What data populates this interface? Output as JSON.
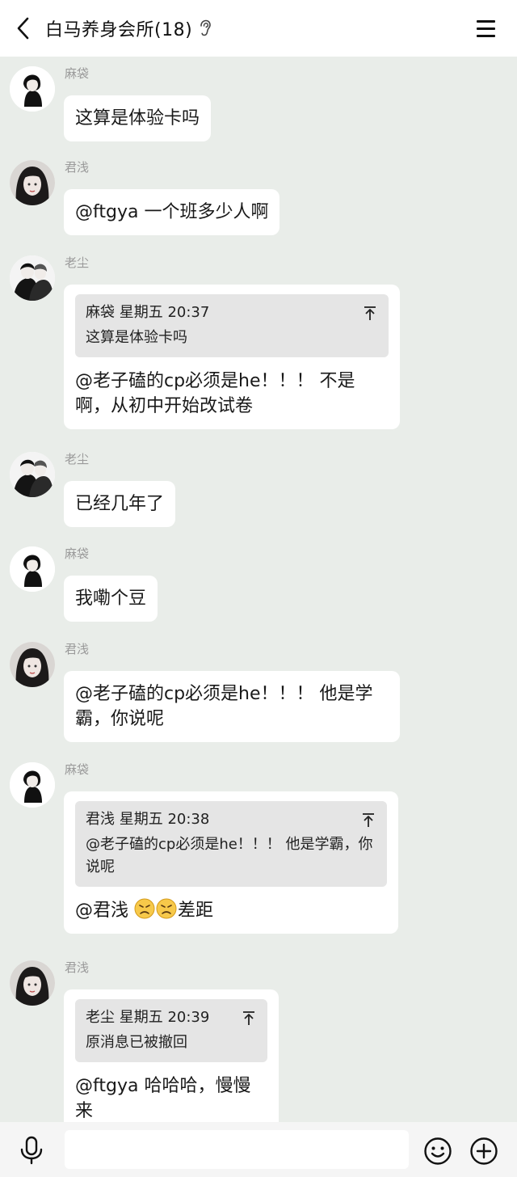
{
  "header": {
    "title": "白马养身会所(18)"
  },
  "icons": {
    "back": "chevron-left-icon",
    "ear": "ear-icon",
    "menu": "hamburger-icon",
    "voice": "microphone-icon",
    "emoji": "smiley-icon",
    "plus": "plus-circle-icon",
    "pin": "arrow-to-top-icon"
  },
  "messages": [
    {
      "sender": "麻袋",
      "text": "这算是体验卡吗"
    },
    {
      "sender": "君浅",
      "text": "@ftgya 一个班多少人啊"
    },
    {
      "sender": "老尘",
      "quote": {
        "head": "麻袋 星期五 20:37",
        "text": "这算是体验卡吗"
      },
      "text": "@老子磕的cp必须是he！！！ 不是啊，从初中开始改试卷"
    },
    {
      "sender": "老尘",
      "text": "已经几年了"
    },
    {
      "sender": "麻袋",
      "text": "我嘞个豆"
    },
    {
      "sender": "君浅",
      "text": "@老子磕的cp必须是he！！！ 他是学霸，你说呢"
    },
    {
      "sender": "麻袋",
      "quote": {
        "head": "君浅 星期五 20:38",
        "text": "@老子磕的cp必须是he！！！ 他是学霸，你说呢"
      },
      "text_prefix": "@君浅 ",
      "text_suffix": "差距",
      "emojis": [
        "frown-emoji",
        "frown-emoji"
      ]
    },
    {
      "sender": "君浅",
      "quote": {
        "head": "老尘 星期五 20:39",
        "text": "原消息已被撤回"
      },
      "text": "@ftgya 哈哈哈，慢慢来"
    }
  ],
  "input": {
    "value": ""
  }
}
